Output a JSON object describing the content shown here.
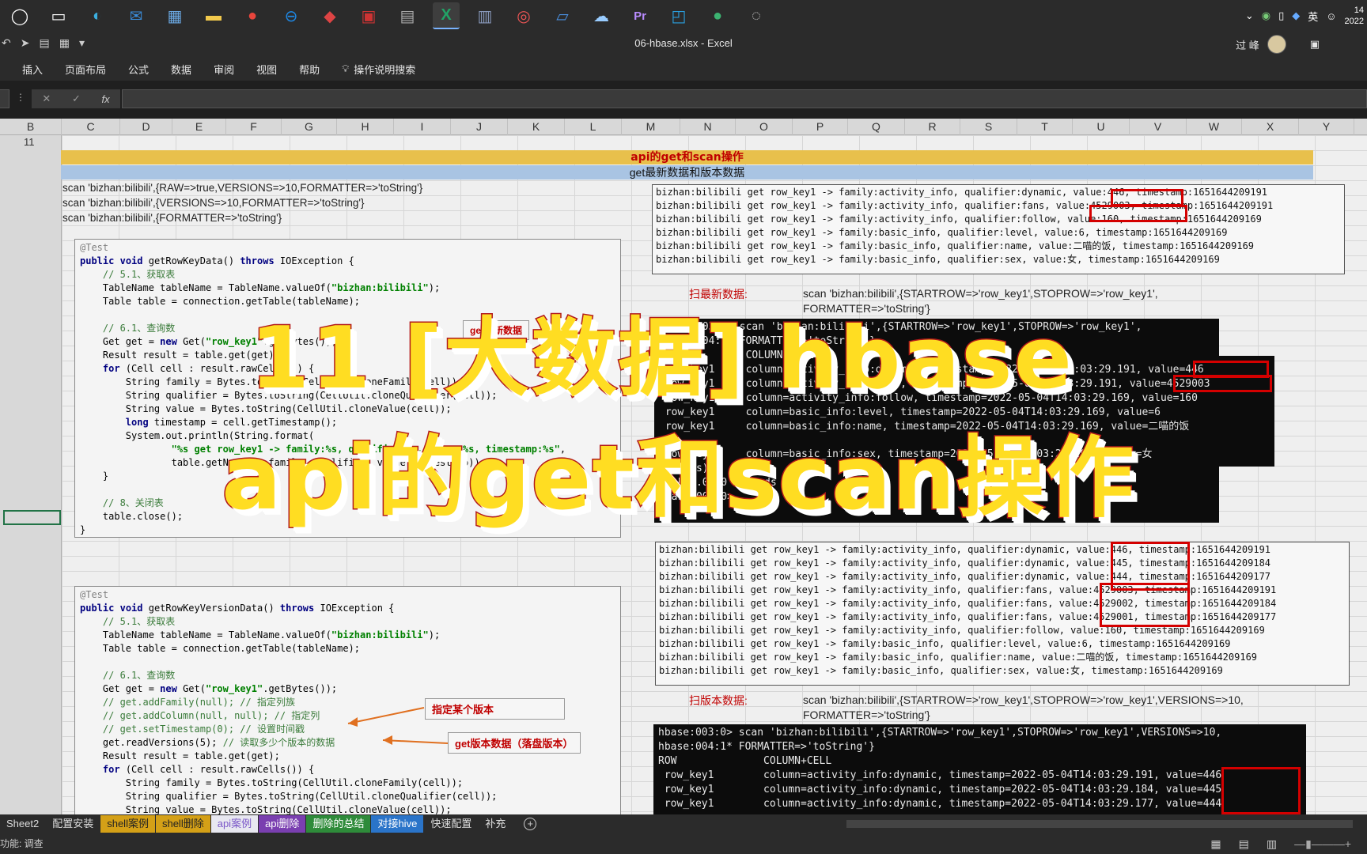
{
  "taskbar": {
    "icons": [
      "start-icon",
      "task-view-icon",
      "edge-icon",
      "mail-icon",
      "store-icon",
      "file-explorer-icon",
      "chrome-icon",
      "teamviewer-icon",
      "app-icon",
      "app-icon",
      "app-icon",
      "excel-icon",
      "app-icon",
      "app-icon",
      "app-icon",
      "app-icon",
      "premiere-icon",
      "app-icon",
      "app-icon",
      "app-icon"
    ],
    "lang": "英",
    "clock_time": "14",
    "clock_date": "2022"
  },
  "window": {
    "title": "06-hbase.xlsx  -  Excel",
    "user": "过 峰"
  },
  "ribbon_tabs": [
    "插入",
    "页面布局",
    "公式",
    "数据",
    "审阅",
    "视图",
    "帮助",
    "操作说明搜索"
  ],
  "formula_bar": {
    "fx": "fx",
    "cancel": "✕",
    "enter": "✓"
  },
  "columns": [
    "B",
    "C",
    "D",
    "E",
    "F",
    "G",
    "H",
    "I",
    "J",
    "K",
    "L",
    "M",
    "N",
    "O",
    "P",
    "Q",
    "R",
    "S",
    "T",
    "U",
    "V",
    "W",
    "X",
    "Y"
  ],
  "row_label": "11",
  "sheet": {
    "title": "api的get和scan操作",
    "subtitle": "get最新数据和版本数据",
    "scan_lines": [
      "scan 'bizhan:bilibili',{RAW=>true,VERSIONS=>10,FORMATTER=>'toString'}",
      "scan 'bizhan:bilibili',{VERSIONS=>10,FORMATTER=>'toString'}",
      "scan 'bizhan:bilibili',{FORMATTER=>'toString'}"
    ],
    "scan_latest_label": "扫最新数据:",
    "scan_latest_cmd_1": "scan 'bizhan:bilibili',{STARTROW=>'row_key1',STOPROW=>'row_key1',",
    "scan_latest_cmd_2": "FORMATTER=>'toString'}",
    "scan_version_label": "扫版本数据:",
    "scan_version_cmd_1": "scan 'bizhan:bilibili',{STARTROW=>'row_key1',STOPROW=>'row_key1',VERSIONS=>10,",
    "scan_version_cmd_2": "FORMATTER=>'toString'}",
    "callout_version": "指定某个版本",
    "callout_get_version": "get版本数据（落盘版本）",
    "callout_hidden": "get最新数据"
  },
  "overlay": {
    "line1": "11 [大数据] hbase",
    "line2": "api的get和scan操作"
  },
  "code1": [
    "@Test",
    "public void getRowKeyData() throws IOException {",
    "    // 5.1、获取表",
    "    TableName tableName = TableName.valueOf(\"bizhan:bilibili\");",
    "    Table table = connection.getTable(tableName);",
    "",
    "    // 6.1、查询数",
    "    Get get = new Get(\"row_key1\".getBytes());",
    "    Result result = table.get(get);",
    "    for (Cell cell : result.rawCells()) {",
    "        String family = Bytes.toString(CellUtil.cloneFamily(cell));",
    "        String qualifier = Bytes.toString(CellUtil.cloneQualifier(cell));",
    "        String value = Bytes.toString(CellUtil.cloneValue(cell));",
    "        long timestamp = cell.getTimestamp();",
    "        System.out.println(String.format(",
    "                \"%s get row_key1 -> family:%s, qualifier:%s, value:%s, timestamp:%s\",",
    "                table.getName(), family, qualifier, value, timestamp));",
    "    }",
    "",
    "    // 8、关闭表",
    "    table.close();",
    "}"
  ],
  "code2": [
    "@Test",
    "public void getRowKeyVersionData() throws IOException {",
    "    // 5.1、获取表",
    "    TableName tableName = TableName.valueOf(\"bizhan:bilibili\");",
    "    Table table = connection.getTable(tableName);",
    "",
    "    // 6.1、查询数",
    "    Get get = new Get(\"row_key1\".getBytes());",
    "    // get.addFamily(null); // 指定列族",
    "    // get.addColumn(null, null); // 指定列",
    "    // get.setTimestamp(0); // 设置时间戳",
    "    get.readVersions(5); // 读取多少个版本的数据",
    "    Result result = table.get(get);",
    "    for (Cell cell : result.rawCells()) {",
    "        String family = Bytes.toString(CellUtil.cloneFamily(cell));",
    "        String qualifier = Bytes.toString(CellUtil.cloneQualifier(cell));",
    "        String value = Bytes.toString(CellUtil.cloneValue(cell));"
  ],
  "out1": [
    "bizhan:bilibili get row_key1 -> family:activity_info, qualifier:dynamic, value:446, timestamp:1651644209191",
    "bizhan:bilibili get row_key1 -> family:activity_info, qualifier:fans, value:4529003, timestamp:1651644209191",
    "bizhan:bilibili get row_key1 -> family:activity_info, qualifier:follow, value:160, timestamp:1651644209169",
    "bizhan:bilibili get row_key1 -> family:basic_info, qualifier:level, value:6, timestamp:1651644209169",
    "bizhan:bilibili get row_key1 -> family:basic_info, qualifier:name, value:二喵的饭, timestamp:1651644209169",
    "bizhan:bilibili get row_key1 -> family:basic_info, qualifier:sex, value:女, timestamp:1651644209169"
  ],
  "term1": [
    "hbase:003:0> scan 'bizhan:bilibili',{STARTROW=>'row_key1',STOPROW=>'row_key1',",
    "hbase:004:1* FORMATTER=>'toString'}",
    "ROW           COLUMN+CELL",
    " row_key1     column=activity_info:dynamic, timestamp=2022-05-04T14:03:29.191, value=446",
    " row_key1     column=activity_info:fans, timestamp=2022-05-04T14:03:29.191, value=4529003",
    " row_key1     column=activity_info:follow, timestamp=2022-05-04T14:03:29.169, value=160",
    " row_key1     column=basic_info:level, timestamp=2022-05-04T14:03:29.169, value=6",
    " row_key1     column=basic_info:name, timestamp=2022-05-04T14:03:29.169, value=二喵的饭",
    "",
    " row_key1     column=basic_info:sex, timestamp=2022-05-04T14:03:29.169, value=女",
    "1 row(s)",
    "Took 0.0140 seconds",
    "hbase:003:0> "
  ],
  "out2": [
    "bizhan:bilibili get row_key1 -> family:activity_info, qualifier:dynamic, value:446, timestamp:1651644209191",
    "bizhan:bilibili get row_key1 -> family:activity_info, qualifier:dynamic, value:445, timestamp:1651644209184",
    "bizhan:bilibili get row_key1 -> family:activity_info, qualifier:dynamic, value:444, timestamp:1651644209177",
    "bizhan:bilibili get row_key1 -> family:activity_info, qualifier:fans, value:4529003, timestamp:1651644209191",
    "bizhan:bilibili get row_key1 -> family:activity_info, qualifier:fans, value:4529002, timestamp:1651644209184",
    "bizhan:bilibili get row_key1 -> family:activity_info, qualifier:fans, value:4529001, timestamp:1651644209177",
    "bizhan:bilibili get row_key1 -> family:activity_info, qualifier:follow, value:160, timestamp:1651644209169",
    "bizhan:bilibili get row_key1 -> family:basic_info, qualifier:level, value:6, timestamp:1651644209169",
    "bizhan:bilibili get row_key1 -> family:basic_info, qualifier:name, value:二喵的饭, timestamp:1651644209169",
    "bizhan:bilibili get row_key1 -> family:basic_info, qualifier:sex, value:女, timestamp:1651644209169"
  ],
  "term2": [
    "hbase:003:0> scan 'bizhan:bilibili',{STARTROW=>'row_key1',STOPROW=>'row_key1',VERSIONS=>10,",
    "hbase:004:1* FORMATTER=>'toString'}",
    "ROW              COLUMN+CELL",
    " row_key1        column=activity_info:dynamic, timestamp=2022-05-04T14:03:29.191, value=446",
    " row_key1        column=activity_info:dynamic, timestamp=2022-05-04T14:03:29.184, value=445",
    " row_key1        column=activity_info:dynamic, timestamp=2022-05-04T14:03:29.177, value=444"
  ],
  "sheet_tabs": [
    {
      "label": "Sheet2",
      "color": "#2b2b2b",
      "text": "#ddd"
    },
    {
      "label": "配置安装",
      "color": "#2b2b2b",
      "text": "#ddd"
    },
    {
      "label": "shell案例",
      "color": "#d4a017",
      "text": "#222"
    },
    {
      "label": "shell删除",
      "color": "#d4a017",
      "text": "#222"
    },
    {
      "label": "api案例",
      "color": "#e8e8f0",
      "text": "#7a56c8"
    },
    {
      "label": "api删除",
      "color": "#7a3fb0",
      "text": "#fff"
    },
    {
      "label": "删除的总结",
      "color": "#2e8b3a",
      "text": "#fff"
    },
    {
      "label": "对接hive",
      "color": "#2a74c9",
      "text": "#fff"
    },
    {
      "label": "快速配置",
      "color": "#2b2b2b",
      "text": "#ddd"
    },
    {
      "label": "补充",
      "color": "#2b2b2b",
      "text": "#ddd"
    }
  ],
  "status_text": "功能: 调查",
  "status_icons": [
    "normal-view-icon",
    "page-layout-icon",
    "page-break-icon"
  ]
}
